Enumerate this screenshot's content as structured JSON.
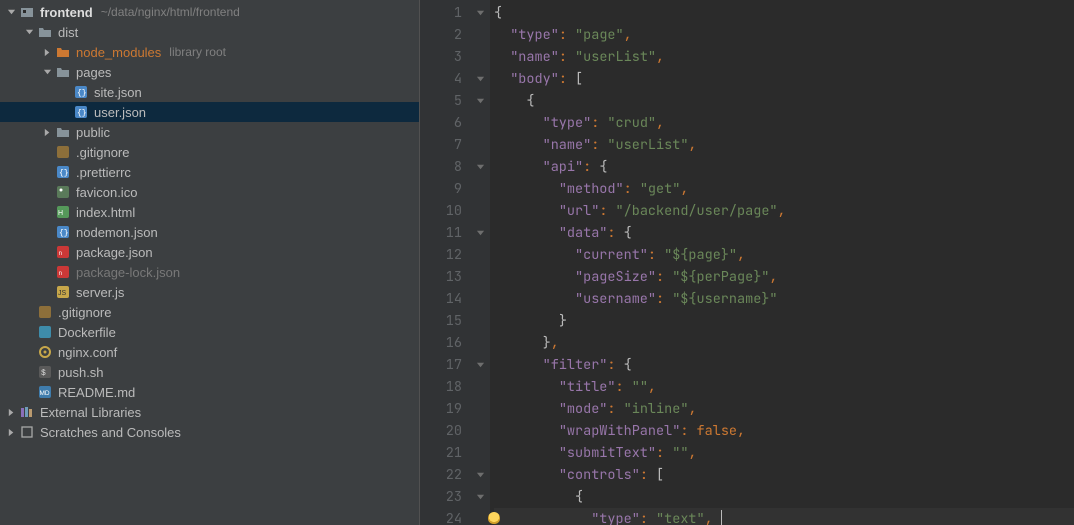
{
  "project": {
    "root": {
      "name": "frontend",
      "path": "~/data/nginx/html/frontend"
    },
    "tree": [
      {
        "id": "dist",
        "label": "dist",
        "type": "dir",
        "depth": 1,
        "expanded": true
      },
      {
        "id": "node_modules",
        "label": "node_modules",
        "hint": "library root",
        "type": "dir-lib",
        "depth": 2,
        "expanded": false
      },
      {
        "id": "pages",
        "label": "pages",
        "type": "dir",
        "depth": 2,
        "expanded": true
      },
      {
        "id": "site_json",
        "label": "site.json",
        "type": "json",
        "depth": 3
      },
      {
        "id": "user_json",
        "label": "user.json",
        "type": "json",
        "depth": 3,
        "selected": true
      },
      {
        "id": "public",
        "label": "public",
        "type": "dir",
        "depth": 2,
        "expanded": false
      },
      {
        "id": "gitignore1",
        "label": ".gitignore",
        "type": "git",
        "depth": 2
      },
      {
        "id": "prettierrc",
        "label": ".prettierrc",
        "type": "json",
        "depth": 2
      },
      {
        "id": "favicon",
        "label": "favicon.ico",
        "type": "image",
        "depth": 2
      },
      {
        "id": "indexhtml",
        "label": "index.html",
        "type": "html",
        "depth": 2
      },
      {
        "id": "nodemon",
        "label": "nodemon.json",
        "type": "json",
        "depth": 2
      },
      {
        "id": "packagejson",
        "label": "package.json",
        "type": "npm",
        "depth": 2
      },
      {
        "id": "packlock",
        "label": "package-lock.json",
        "type": "npm",
        "depth": 2,
        "muted": true
      },
      {
        "id": "server",
        "label": "server.js",
        "type": "js",
        "depth": 2
      },
      {
        "id": "gitignore2",
        "label": ".gitignore",
        "type": "git",
        "depth": 1
      },
      {
        "id": "dockerfile",
        "label": "Dockerfile",
        "type": "docker",
        "depth": 1
      },
      {
        "id": "nginxconf",
        "label": "nginx.conf",
        "type": "conf",
        "depth": 1
      },
      {
        "id": "pushsh",
        "label": "push.sh",
        "type": "sh",
        "depth": 1
      },
      {
        "id": "readme",
        "label": "README.md",
        "type": "md",
        "depth": 1
      }
    ],
    "externals": "External Libraries",
    "scratches": "Scratches and Consoles"
  },
  "editor": {
    "lines": [
      {
        "n": 1,
        "fold": "down",
        "tokens": [
          [
            "br",
            "{"
          ]
        ]
      },
      {
        "n": 2,
        "tokens": [
          [
            "sp",
            "  "
          ],
          [
            "p",
            "\"type\""
          ],
          [
            "pu",
            ": "
          ],
          [
            "s",
            "\"page\""
          ],
          [
            "pu",
            ","
          ]
        ]
      },
      {
        "n": 3,
        "tokens": [
          [
            "sp",
            "  "
          ],
          [
            "p",
            "\"name\""
          ],
          [
            "pu",
            ": "
          ],
          [
            "s",
            "\"userList\""
          ],
          [
            "pu",
            ","
          ]
        ]
      },
      {
        "n": 4,
        "fold": "down",
        "tokens": [
          [
            "sp",
            "  "
          ],
          [
            "p",
            "\"body\""
          ],
          [
            "pu",
            ": "
          ],
          [
            "br",
            "["
          ]
        ]
      },
      {
        "n": 5,
        "fold": "down",
        "tokens": [
          [
            "sp",
            "    "
          ],
          [
            "br",
            "{"
          ]
        ]
      },
      {
        "n": 6,
        "tokens": [
          [
            "sp",
            "      "
          ],
          [
            "p",
            "\"type\""
          ],
          [
            "pu",
            ": "
          ],
          [
            "s",
            "\"crud\""
          ],
          [
            "pu",
            ","
          ]
        ]
      },
      {
        "n": 7,
        "tokens": [
          [
            "sp",
            "      "
          ],
          [
            "p",
            "\"name\""
          ],
          [
            "pu",
            ": "
          ],
          [
            "s",
            "\"userList\""
          ],
          [
            "pu",
            ","
          ]
        ]
      },
      {
        "n": 8,
        "fold": "down",
        "tokens": [
          [
            "sp",
            "      "
          ],
          [
            "p",
            "\"api\""
          ],
          [
            "pu",
            ": "
          ],
          [
            "br",
            "{"
          ]
        ]
      },
      {
        "n": 9,
        "tokens": [
          [
            "sp",
            "        "
          ],
          [
            "p",
            "\"method\""
          ],
          [
            "pu",
            ": "
          ],
          [
            "s",
            "\"get\""
          ],
          [
            "pu",
            ","
          ]
        ]
      },
      {
        "n": 10,
        "tokens": [
          [
            "sp",
            "        "
          ],
          [
            "p",
            "\"url\""
          ],
          [
            "pu",
            ": "
          ],
          [
            "s",
            "\"/backend/user/page\""
          ],
          [
            "pu",
            ","
          ]
        ]
      },
      {
        "n": 11,
        "fold": "down",
        "tokens": [
          [
            "sp",
            "        "
          ],
          [
            "p",
            "\"data\""
          ],
          [
            "pu",
            ": "
          ],
          [
            "br",
            "{"
          ]
        ]
      },
      {
        "n": 12,
        "tokens": [
          [
            "sp",
            "          "
          ],
          [
            "p",
            "\"current\""
          ],
          [
            "pu",
            ": "
          ],
          [
            "s",
            "\"${page}\""
          ],
          [
            "pu",
            ","
          ]
        ]
      },
      {
        "n": 13,
        "tokens": [
          [
            "sp",
            "          "
          ],
          [
            "p",
            "\"pageSize\""
          ],
          [
            "pu",
            ": "
          ],
          [
            "s",
            "\"${perPage}\""
          ],
          [
            "pu",
            ","
          ]
        ]
      },
      {
        "n": 14,
        "tokens": [
          [
            "sp",
            "          "
          ],
          [
            "p",
            "\"username\""
          ],
          [
            "pu",
            ": "
          ],
          [
            "s",
            "\"${username}\""
          ]
        ]
      },
      {
        "n": 15,
        "tokens": [
          [
            "sp",
            "        "
          ],
          [
            "br",
            "}"
          ]
        ]
      },
      {
        "n": 16,
        "tokens": [
          [
            "sp",
            "      "
          ],
          [
            "br",
            "}"
          ],
          [
            "pu",
            ","
          ]
        ]
      },
      {
        "n": 17,
        "fold": "down",
        "tokens": [
          [
            "sp",
            "      "
          ],
          [
            "p",
            "\"filter\""
          ],
          [
            "pu",
            ": "
          ],
          [
            "br",
            "{"
          ]
        ]
      },
      {
        "n": 18,
        "tokens": [
          [
            "sp",
            "        "
          ],
          [
            "p",
            "\"title\""
          ],
          [
            "pu",
            ": "
          ],
          [
            "s",
            "\"\""
          ],
          [
            "pu",
            ","
          ]
        ]
      },
      {
        "n": 19,
        "tokens": [
          [
            "sp",
            "        "
          ],
          [
            "p",
            "\"mode\""
          ],
          [
            "pu",
            ": "
          ],
          [
            "s",
            "\"inline\""
          ],
          [
            "pu",
            ","
          ]
        ]
      },
      {
        "n": 20,
        "tokens": [
          [
            "sp",
            "        "
          ],
          [
            "p",
            "\"wrapWithPanel\""
          ],
          [
            "pu",
            ": "
          ],
          [
            "bo",
            "false"
          ],
          [
            "pu",
            ","
          ]
        ]
      },
      {
        "n": 21,
        "tokens": [
          [
            "sp",
            "        "
          ],
          [
            "p",
            "\"submitText\""
          ],
          [
            "pu",
            ": "
          ],
          [
            "s",
            "\"\""
          ],
          [
            "pu",
            ","
          ]
        ]
      },
      {
        "n": 22,
        "fold": "down",
        "tokens": [
          [
            "sp",
            "        "
          ],
          [
            "p",
            "\"controls\""
          ],
          [
            "pu",
            ": "
          ],
          [
            "br",
            "["
          ]
        ]
      },
      {
        "n": 23,
        "fold": "down",
        "tokens": [
          [
            "sp",
            "          "
          ],
          [
            "br",
            "{"
          ]
        ]
      },
      {
        "n": 24,
        "bulb": true,
        "hl": true,
        "tokens": [
          [
            "sp",
            "            "
          ],
          [
            "p",
            "\"type\""
          ],
          [
            "pu",
            ": "
          ],
          [
            "s",
            "\"text\""
          ],
          [
            "pu",
            ","
          ],
          [
            "cursor",
            ""
          ]
        ]
      }
    ]
  }
}
